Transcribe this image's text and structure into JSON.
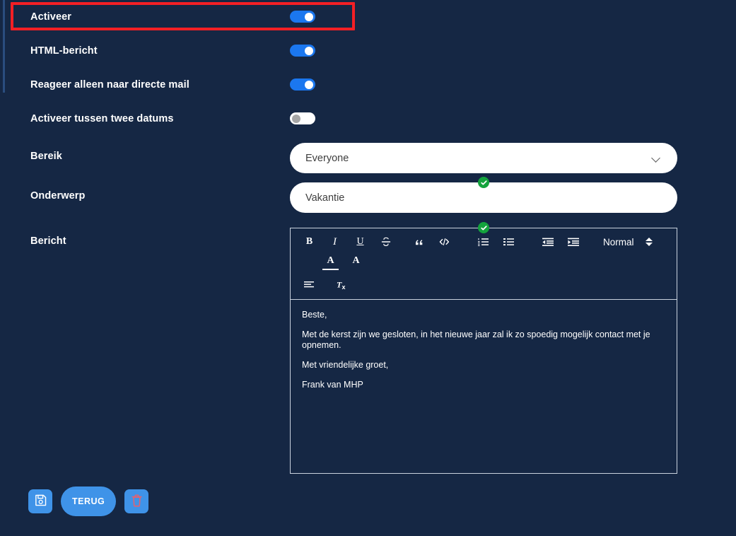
{
  "theme": {
    "background": "#152744",
    "accent_blue": "#1b77ef",
    "button_blue": "#3f93e8",
    "valid_green": "#14a33d",
    "highlight_red": "#f31f25",
    "field_white": "#ffffff"
  },
  "form": {
    "rows": [
      {
        "label": "Activeer",
        "control": "toggle",
        "state": "on",
        "highlighted": true
      },
      {
        "label": "HTML-bericht",
        "control": "toggle",
        "state": "on",
        "highlighted": false
      },
      {
        "label": "Reageer alleen naar directe mail",
        "control": "toggle",
        "state": "on",
        "highlighted": false
      },
      {
        "label": "Activeer tussen twee datums",
        "control": "toggle",
        "state": "off",
        "highlighted": false
      },
      {
        "label": "Bereik",
        "control": "select"
      },
      {
        "label": "Onderwerp",
        "control": "text"
      },
      {
        "label": "Bericht",
        "control": "editor"
      }
    ]
  },
  "scope_select": {
    "value": "Everyone",
    "placeholder": "Everyone",
    "chevron": "chevron-down-icon"
  },
  "subject_field": {
    "value": "Vakantie",
    "placeholder": "Onderwerp",
    "valid": true
  },
  "message_editor": {
    "valid": true,
    "toolbar": {
      "bold": "B",
      "italic": "I",
      "underline": "U",
      "strike": "S",
      "blockquote": "”",
      "code": "</>",
      "ordered_list": "ordered-list-icon",
      "bullet_list": "bullet-list-icon",
      "outdent": "outdent-icon",
      "indent": "indent-icon",
      "format_label": "Normal",
      "format_stepper": "up-down-arrows-icon",
      "font_color": "A",
      "background_color": "A",
      "align": "align-icon",
      "clear_format": "Tx"
    },
    "body_paragraphs": [
      "Beste,",
      "Met de kerst zijn we gesloten, in het nieuwe jaar zal ik zo spoedig mogelijk contact met je opnemen.",
      "Met vriendelijke groet,",
      "Frank van MHP"
    ]
  },
  "actions": {
    "save_icon": "floppy-disk-save-icon",
    "back_label": "TERUG",
    "delete_icon": "trash-can-icon"
  }
}
